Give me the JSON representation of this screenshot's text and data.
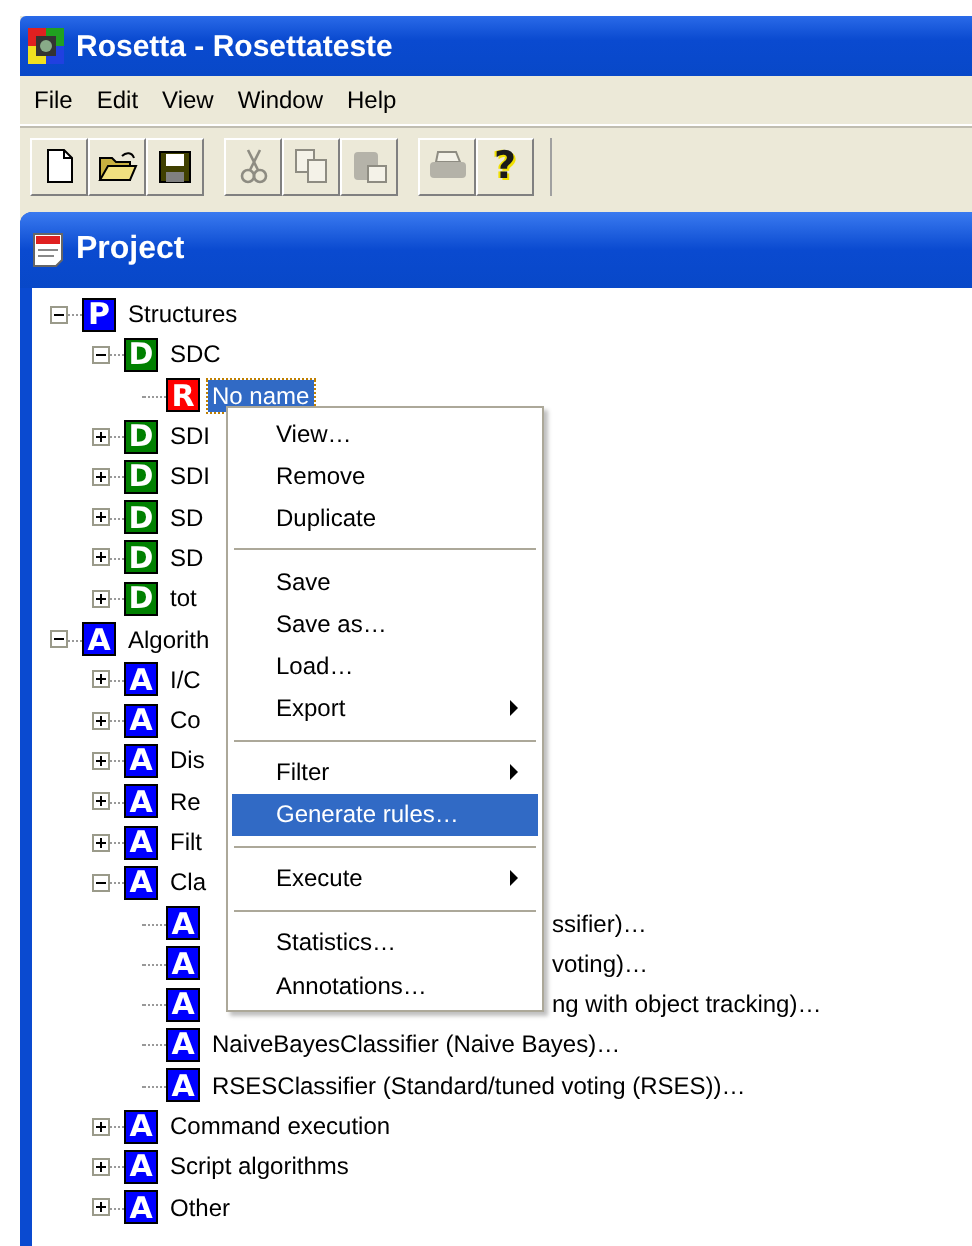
{
  "window": {
    "title": "Rosetta - Rosettateste"
  },
  "menu_bar": [
    "File",
    "Edit",
    "View",
    "Window",
    "Help"
  ],
  "toolbar": [
    [
      {
        "kind": "new",
        "disabled": false
      },
      {
        "kind": "open",
        "disabled": false
      },
      {
        "kind": "save",
        "disabled": false
      }
    ],
    [
      {
        "kind": "cut",
        "disabled": true
      },
      {
        "kind": "copy",
        "disabled": true
      },
      {
        "kind": "paste",
        "disabled": true
      }
    ],
    [
      {
        "kind": "print",
        "disabled": true
      },
      {
        "kind": "help",
        "disabled": false,
        "label": "?"
      }
    ]
  ],
  "panel": {
    "title": "Project"
  },
  "tree": [
    {
      "label": "Structures",
      "badge": "P",
      "color": "#0000ff",
      "expanded": true,
      "selected": false,
      "children": [
        {
          "label": "SDC",
          "badge": "D",
          "color": "#008000",
          "expanded": true,
          "selected": false,
          "children": [
            {
              "label": "No name",
              "badge": "R",
              "color": "#ff0000",
              "selected": true
            }
          ]
        },
        {
          "label": "SDI",
          "badge": "D",
          "color": "#008000",
          "expanded": false,
          "selected": false
        },
        {
          "label": "SDI",
          "badge": "D",
          "color": "#008000",
          "expanded": false,
          "selected": false
        },
        {
          "label": "SD",
          "badge": "D",
          "color": "#008000",
          "expanded": false,
          "selected": false
        },
        {
          "label": "SD",
          "badge": "D",
          "color": "#008000",
          "expanded": false,
          "selected": false
        },
        {
          "label": "tot",
          "badge": "D",
          "color": "#008000",
          "expanded": false,
          "selected": false
        }
      ]
    },
    {
      "label": "Algorith",
      "badge": "A",
      "color": "#0000ff",
      "expanded": true,
      "selected": false,
      "children": [
        {
          "label": "I/C",
          "badge": "A",
          "color": "#0000ff",
          "expanded": false,
          "selected": false
        },
        {
          "label": "Co",
          "badge": "A",
          "color": "#0000ff",
          "expanded": false,
          "selected": false
        },
        {
          "label": "Dis",
          "badge": "A",
          "color": "#0000ff",
          "expanded": false,
          "selected": false
        },
        {
          "label": "Re",
          "badge": "A",
          "color": "#0000ff",
          "expanded": false,
          "selected": false
        },
        {
          "label": "Filt",
          "badge": "A",
          "color": "#0000ff",
          "expanded": false,
          "selected": false
        },
        {
          "label": "Cla",
          "badge": "A",
          "color": "#0000ff",
          "expanded": true,
          "selected": false,
          "children": [
            {
              "label": "ssifier)…",
              "badge": "A",
              "color": "#0000ff",
              "covered": true,
              "selected": false
            },
            {
              "label": "voting)…",
              "badge": "A",
              "color": "#0000ff",
              "covered": true,
              "selected": false
            },
            {
              "label": "ng with object tracking)…",
              "badge": "A",
              "color": "#0000ff",
              "covered": true,
              "selected": false
            },
            {
              "label": "NaiveBayesClassifier (Naive Bayes)…",
              "badge": "A",
              "color": "#0000ff",
              "covered": false,
              "selected": false
            },
            {
              "label": "RSESClassifier (Standard/tuned voting (RSES))…",
              "badge": "A",
              "color": "#0000ff",
              "covered": false,
              "selected": false
            }
          ]
        },
        {
          "label": "Command execution",
          "badge": "A",
          "color": "#0000ff",
          "expanded": false,
          "selected": false
        },
        {
          "label": "Script algorithms",
          "badge": "A",
          "color": "#0000ff",
          "expanded": false,
          "selected": false
        },
        {
          "label": "Other",
          "badge": "A",
          "color": "#0000ff",
          "expanded": false,
          "selected": false
        }
      ]
    }
  ],
  "context_menu": [
    {
      "kind": "item",
      "label": "View…",
      "submenu": false,
      "selected": false
    },
    {
      "kind": "item",
      "label": "Remove",
      "submenu": false,
      "selected": false
    },
    {
      "kind": "item",
      "label": "Duplicate",
      "submenu": false,
      "selected": false
    },
    {
      "kind": "separator"
    },
    {
      "kind": "item",
      "label": "Save",
      "submenu": false,
      "selected": false
    },
    {
      "kind": "item",
      "label": "Save as…",
      "submenu": false,
      "selected": false
    },
    {
      "kind": "item",
      "label": "Load…",
      "submenu": false,
      "selected": false
    },
    {
      "kind": "item",
      "label": "Export",
      "submenu": true,
      "selected": false
    },
    {
      "kind": "separator"
    },
    {
      "kind": "item",
      "label": "Filter",
      "submenu": true,
      "selected": false
    },
    {
      "kind": "item",
      "label": "Generate rules…",
      "submenu": false,
      "selected": true
    },
    {
      "kind": "separator"
    },
    {
      "kind": "item",
      "label": "Execute",
      "submenu": true,
      "selected": false
    },
    {
      "kind": "separator"
    },
    {
      "kind": "item",
      "label": "Statistics…",
      "submenu": false,
      "selected": false
    },
    {
      "kind": "item",
      "label": "Annotations…",
      "submenu": false,
      "selected": false
    }
  ]
}
